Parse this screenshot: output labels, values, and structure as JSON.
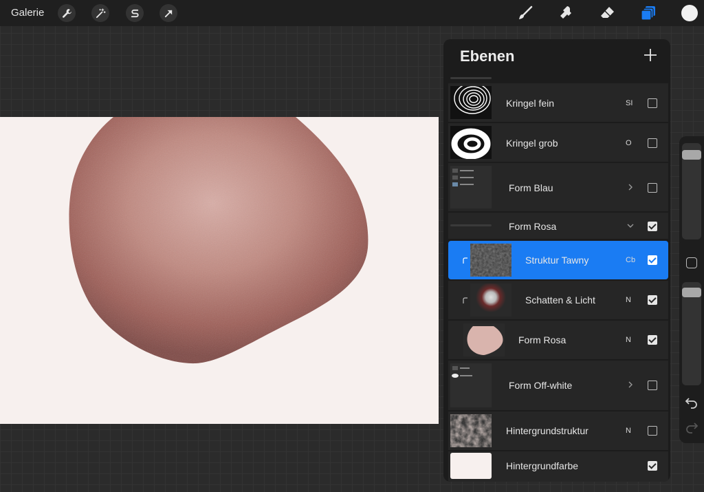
{
  "toolbar": {
    "gallery_label": "Galerie",
    "left_tools": [
      "wrench-icon",
      "magic-wand-icon",
      "selection-s-icon",
      "arrow-transform-icon"
    ],
    "right_tools": [
      "brush-icon",
      "smudge-icon",
      "eraser-icon",
      "layers-icon"
    ],
    "accent_color": "#1a7cf3",
    "current_color": "#f1f1f1"
  },
  "panel": {
    "title": "Ebenen",
    "add_icon": "plus-icon",
    "layers": [
      {
        "name": "Kringel fein",
        "mode": "SI",
        "visible": false
      },
      {
        "name": "Kringel grob",
        "mode": "O",
        "visible": false
      },
      {
        "name": "Form Blau",
        "mode": "",
        "visible": false,
        "group": true,
        "expanded": false
      },
      {
        "name": "Form Rosa",
        "mode": "",
        "visible": true,
        "group": true,
        "expanded": true
      },
      {
        "name": "Struktur Tawny",
        "mode": "Cb",
        "visible": true,
        "active": true,
        "clipped": true
      },
      {
        "name": "Schatten & Licht",
        "mode": "N",
        "visible": true,
        "clipped": true
      },
      {
        "name": "Form Rosa",
        "mode": "N",
        "visible": true
      },
      {
        "name": "Form Off-white",
        "mode": "",
        "visible": false,
        "group": true,
        "expanded": false
      },
      {
        "name": "Hintergrundstruktur",
        "mode": "N",
        "visible": false
      },
      {
        "name": "Hintergrundfarbe",
        "mode": "",
        "visible": true
      }
    ]
  },
  "canvas": {
    "background_color": "#f7f0ee",
    "shape_color": "#b67a72"
  }
}
